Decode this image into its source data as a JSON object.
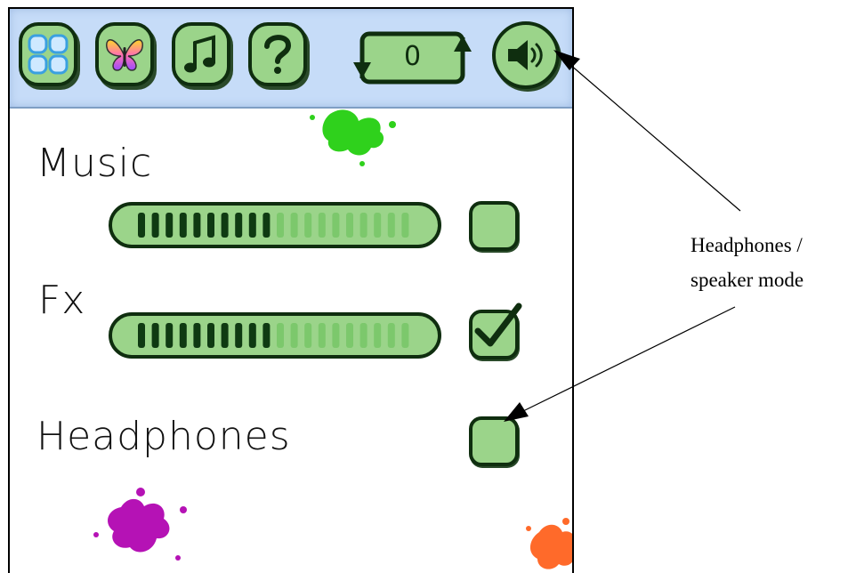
{
  "toolbar": {
    "counter_value": "0",
    "buttons": [
      {
        "name": "menu-grid-icon"
      },
      {
        "name": "butterfly-icon"
      },
      {
        "name": "music-note-icon"
      },
      {
        "name": "question-mark-icon"
      }
    ],
    "sound_icon": "speaker-icon"
  },
  "settings": {
    "music": {
      "label": "Music",
      "volume_fraction": 0.5,
      "checked": false
    },
    "fx": {
      "label": "Fx",
      "volume_fraction": 0.5,
      "checked": true
    },
    "headphones": {
      "label": "Headphones",
      "checked": false
    }
  },
  "annotation": {
    "line1": "Headphones /",
    "line2": "speaker mode"
  },
  "colors": {
    "button_fill": "#9bd48a",
    "outline": "#0f2e0f",
    "toolbar_bg": "#c6dcf8",
    "splat_green": "#2fd11c",
    "splat_purple": "#b512b5",
    "splat_orange": "#ff6a2a"
  }
}
